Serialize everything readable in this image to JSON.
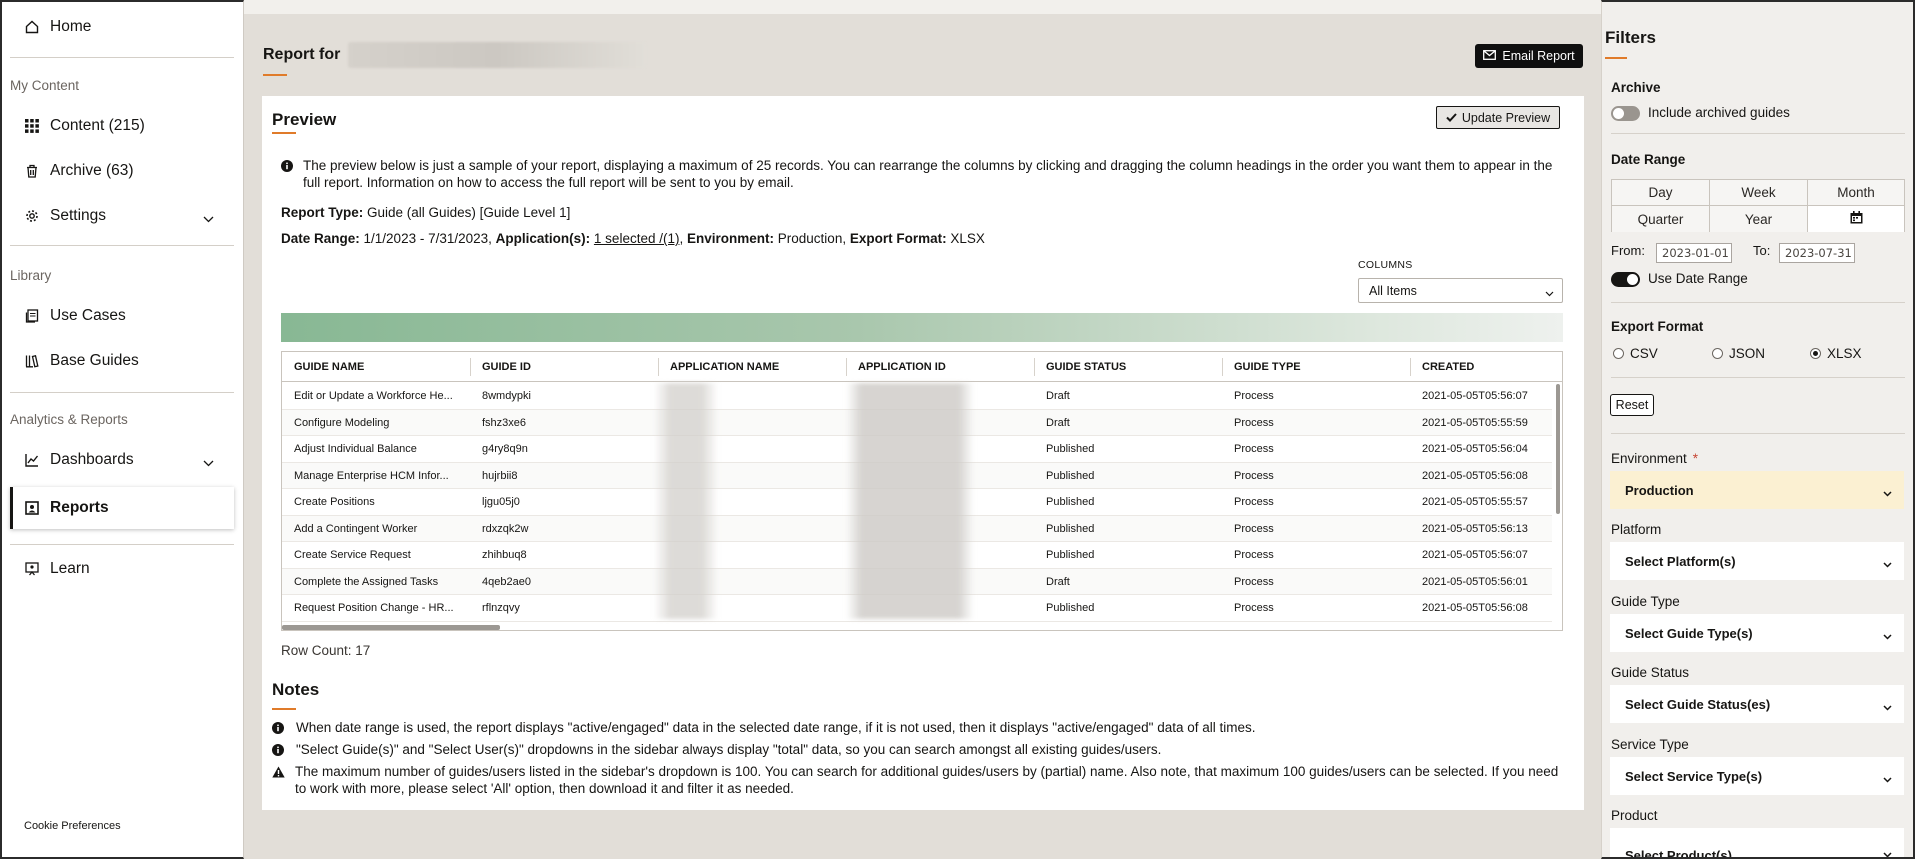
{
  "sidebar": {
    "home": "Home",
    "my_content_section": "My Content",
    "content": "Content (215)",
    "archive": "Archive (63)",
    "settings": "Settings",
    "library_section": "Library",
    "use_cases": "Use Cases",
    "base_guides": "Base Guides",
    "analytics_section": "Analytics & Reports",
    "dashboards": "Dashboards",
    "reports": "Reports",
    "learn": "Learn",
    "cookie": "Cookie Preferences"
  },
  "header": {
    "title": "Report for",
    "email_button": "Email Report"
  },
  "preview": {
    "title": "Preview",
    "update_button": "Update Preview",
    "info": "The preview below is just a sample of your report, displaying a maximum of 25 records. You can rearrange the columns by clicking and dragging the column headings in the order you want them to appear in the full report. Information on how to access the full report will be sent to you by email.",
    "report_type_label": "Report Type:",
    "report_type_value": "Guide (all Guides) [Guide Level 1]",
    "date_range_label": "Date Range:",
    "date_range_value": "1/1/2023 - 7/31/2023,",
    "applications_label": "Application(s):",
    "applications_value": "1 selected /(1)",
    "environment_label": "Environment:",
    "environment_value": "Production,",
    "export_label": "Export Format:",
    "export_value": "XLSX",
    "columns_label": "COLUMNS",
    "columns_value": "All Items",
    "row_count": "Row Count: 17"
  },
  "table": {
    "headers": [
      "GUIDE NAME",
      "GUIDE ID",
      "APPLICATION NAME",
      "APPLICATION ID",
      "GUIDE STATUS",
      "GUIDE TYPE",
      "CREATED"
    ],
    "rows": [
      [
        "Edit or Update a Workforce He...",
        "8wmdypki",
        "",
        "",
        "Draft",
        "Process",
        "2021-05-05T05:56:07"
      ],
      [
        "Configure Modeling",
        "fshz3xe6",
        "",
        "",
        "Draft",
        "Process",
        "2021-05-05T05:55:59"
      ],
      [
        "Adjust Individual Balance",
        "g4ry8q9n",
        "",
        "",
        "Published",
        "Process",
        "2021-05-05T05:56:04"
      ],
      [
        "Manage Enterprise HCM Infor...",
        "hujrbii8",
        "",
        "",
        "Published",
        "Process",
        "2021-05-05T05:56:08"
      ],
      [
        "Create Positions",
        "ljgu05j0",
        "",
        "",
        "Published",
        "Process",
        "2021-05-05T05:55:57"
      ],
      [
        "Add a Contingent Worker",
        "rdxzqk2w",
        "",
        "",
        "Published",
        "Process",
        "2021-05-05T05:56:13"
      ],
      [
        "Create Service Request",
        "zhihbuq8",
        "",
        "",
        "Published",
        "Process",
        "2021-05-05T05:56:07"
      ],
      [
        "Complete the Assigned Tasks",
        "4qeb2ae0",
        "",
        "",
        "Draft",
        "Process",
        "2021-05-05T05:56:01"
      ],
      [
        "Request Position Change - HR...",
        "rflnzqvy",
        "",
        "",
        "Published",
        "Process",
        "2021-05-05T05:56:08"
      ]
    ]
  },
  "notes": {
    "title": "Notes",
    "items": [
      "When date range is used, the report displays \"active/engaged\" data in the selected date range, if it is not used, then it displays \"active/engaged\" data of all times.",
      "\"Select Guide(s)\" and \"Select User(s)\" dropdowns in the sidebar always display \"total\" data, so you can search amongst all existing guides/users.",
      "The maximum number of guides/users listed in the sidebar's dropdown is 100. You can search for additional guides/users by (partial) name. Also note, that maximum 100 guides/users can be selected. If you need to work with more, please select 'All' option, then download it and filter it as needed."
    ]
  },
  "filters": {
    "title": "Filters",
    "archive_label": "Archive",
    "archive_toggle": "Include archived guides",
    "date_range_label": "Date Range",
    "ranges": [
      "Day",
      "Week",
      "Month",
      "Quarter",
      "Year"
    ],
    "from_label": "From:",
    "from_value": "2023-01-01",
    "to_label": "To:",
    "to_value": "2023-07-31",
    "use_date_range": "Use Date Range",
    "export_label": "Export Format",
    "export_options": [
      "CSV",
      "JSON",
      "XLSX"
    ],
    "reset": "Reset",
    "environment_label": "Environment",
    "required_mark": "*",
    "environment_value": "Production",
    "platform_label": "Platform",
    "platform_value": "Select Platform(s)",
    "guide_type_label": "Guide Type",
    "guide_type_value": "Select Guide Type(s)",
    "guide_status_label": "Guide Status",
    "guide_status_value": "Select Guide Status(es)",
    "service_type_label": "Service Type",
    "service_type_value": "Select Service Type(s)",
    "product_label": "Product",
    "product_value": "Select Product(s)"
  },
  "colors": {
    "accent": "#e07b2a",
    "environment_highlight": "#fbf0d2",
    "dark": "#161513"
  }
}
